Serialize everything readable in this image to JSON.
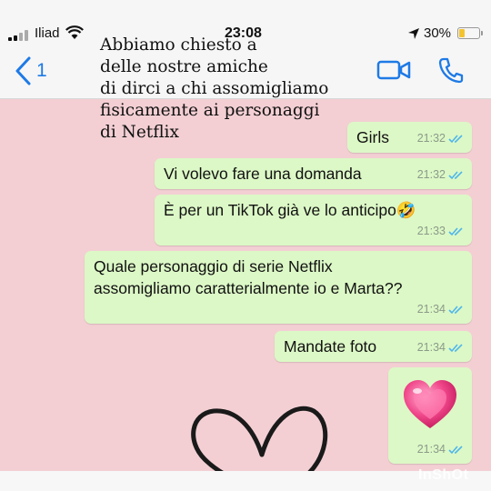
{
  "status_bar": {
    "carrier": "Iliad",
    "time": "23:08",
    "battery_percent": "30%",
    "battery_level": 0.3
  },
  "header": {
    "back_count": "1"
  },
  "overlay_caption": "Abbiamo chiesto a\ndelle nostre amiche\n di  dirci a chi assomigliamo\nfisicamente ai personaggi\ndi Netflix",
  "messages": [
    {
      "text": "Girls",
      "time": "21:32"
    },
    {
      "text": "Vi volevo fare una domanda",
      "time": "21:32"
    },
    {
      "text": "È per un TikTok già ve lo anticipo🤣",
      "time": "21:33"
    },
    {
      "text": "Quale personaggio di serie Netflix\nassomigliamo caratterialmente io e Marta??",
      "time": "21:34"
    },
    {
      "text": "Mandate foto",
      "time": "21:34"
    },
    {
      "emoji": "sparkling-heart",
      "time": "21:34"
    }
  ],
  "watermark": "InShOt",
  "colors": {
    "bubble": "#dcf8c6",
    "background": "#f3cfd3",
    "accent": "#1e7ae6",
    "ticks": "#4fb6ec"
  }
}
